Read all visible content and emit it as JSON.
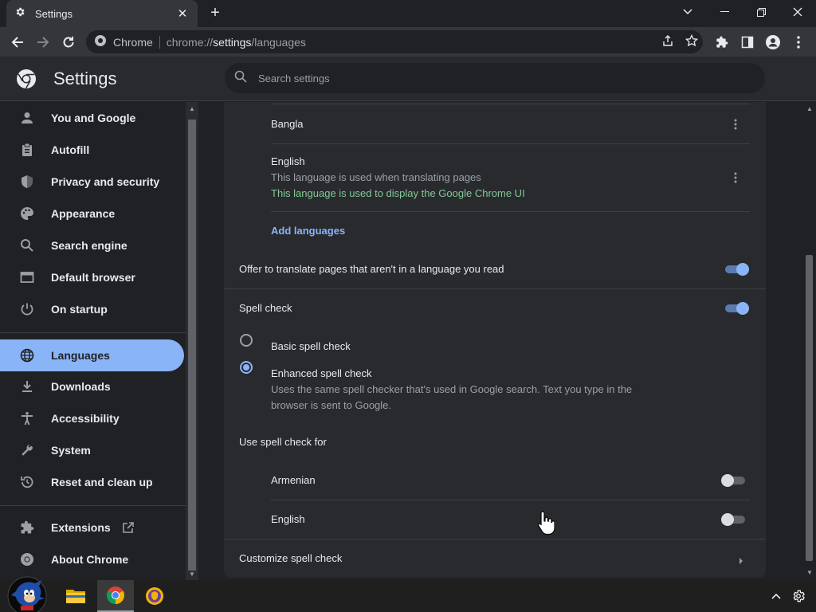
{
  "browser": {
    "tab_title": "Settings",
    "omnibox_site": "Chrome",
    "url_scheme": "chrome://",
    "url_host": "settings",
    "url_path": "/languages"
  },
  "header": {
    "title": "Settings",
    "search_placeholder": "Search settings"
  },
  "sidebar": {
    "items": [
      {
        "label": "You and Google",
        "icon": "person-icon"
      },
      {
        "label": "Autofill",
        "icon": "clipboard-icon"
      },
      {
        "label": "Privacy and security",
        "icon": "shield-icon"
      },
      {
        "label": "Appearance",
        "icon": "palette-icon"
      },
      {
        "label": "Search engine",
        "icon": "search-icon"
      },
      {
        "label": "Default browser",
        "icon": "browser-icon"
      },
      {
        "label": "On startup",
        "icon": "power-icon"
      },
      {
        "label": "Languages",
        "icon": "globe-icon"
      },
      {
        "label": "Downloads",
        "icon": "download-icon"
      },
      {
        "label": "Accessibility",
        "icon": "accessibility-icon"
      },
      {
        "label": "System",
        "icon": "wrench-icon"
      },
      {
        "label": "Reset and clean up",
        "icon": "reset-icon"
      },
      {
        "label": "Extensions",
        "icon": "puzzle-icon"
      },
      {
        "label": "About Chrome",
        "icon": "chrome-icon"
      }
    ],
    "active": "Languages"
  },
  "languages": {
    "items": [
      {
        "name": "Bangla"
      },
      {
        "name": "English",
        "note": "This language is used when translating pages",
        "ui_note": "This language is used to display the Google Chrome UI"
      }
    ],
    "add_languages": "Add languages",
    "offer_translate": "Offer to translate pages that aren't in a language you read",
    "offer_translate_on": true
  },
  "spellcheck": {
    "title": "Spell check",
    "enabled": true,
    "basic_label": "Basic spell check",
    "enhanced_label": "Enhanced spell check",
    "enhanced_desc_line1": "Uses the same spell checker that's used in Google search. Text you type in the",
    "enhanced_desc_line2": "browser is sent to Google.",
    "selected": "Enhanced spell check",
    "use_for_title": "Use spell check for",
    "languages": [
      {
        "name": "Armenian",
        "enabled": false
      },
      {
        "name": "English",
        "enabled": false
      }
    ],
    "customize": "Customize spell check"
  },
  "colors": {
    "accent": "#8ab4f8",
    "green_note": "#81c995",
    "background": "#202124",
    "card": "#292a2d"
  }
}
